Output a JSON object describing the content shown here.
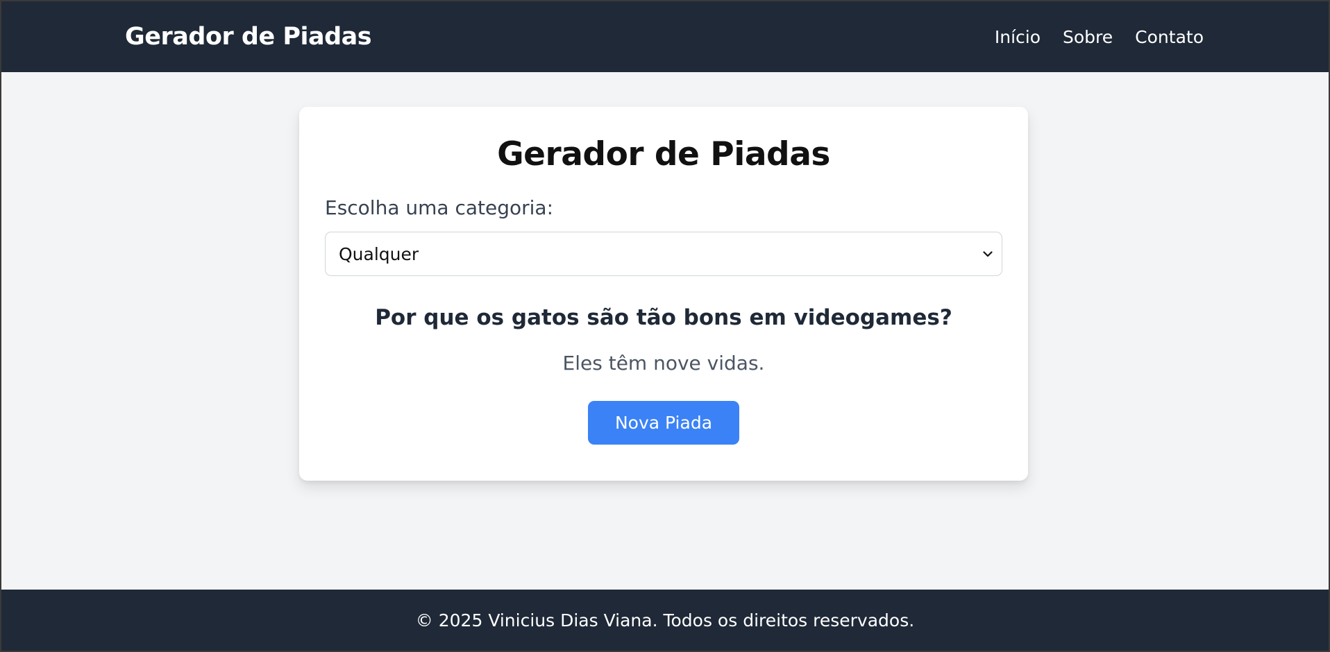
{
  "header": {
    "brand": "Gerador de Piadas",
    "nav": [
      "Início",
      "Sobre",
      "Contato"
    ]
  },
  "card": {
    "title": "Gerador de Piadas",
    "category_label": "Escolha uma categoria:",
    "category_selected": "Qualquer",
    "joke_setup": "Por que os gatos são tão bons em videogames?",
    "joke_punchline": "Eles têm nove vidas.",
    "button_label": "Nova Piada"
  },
  "footer": {
    "text": "© 2025 Vinicius Dias Viana. Todos os direitos reservados."
  },
  "colors": {
    "navbar_bg": "#1f2937",
    "page_bg": "#f3f4f6",
    "button_bg": "#3b82f6"
  },
  "icons": {
    "select_arrow": "chevron-down-icon"
  }
}
